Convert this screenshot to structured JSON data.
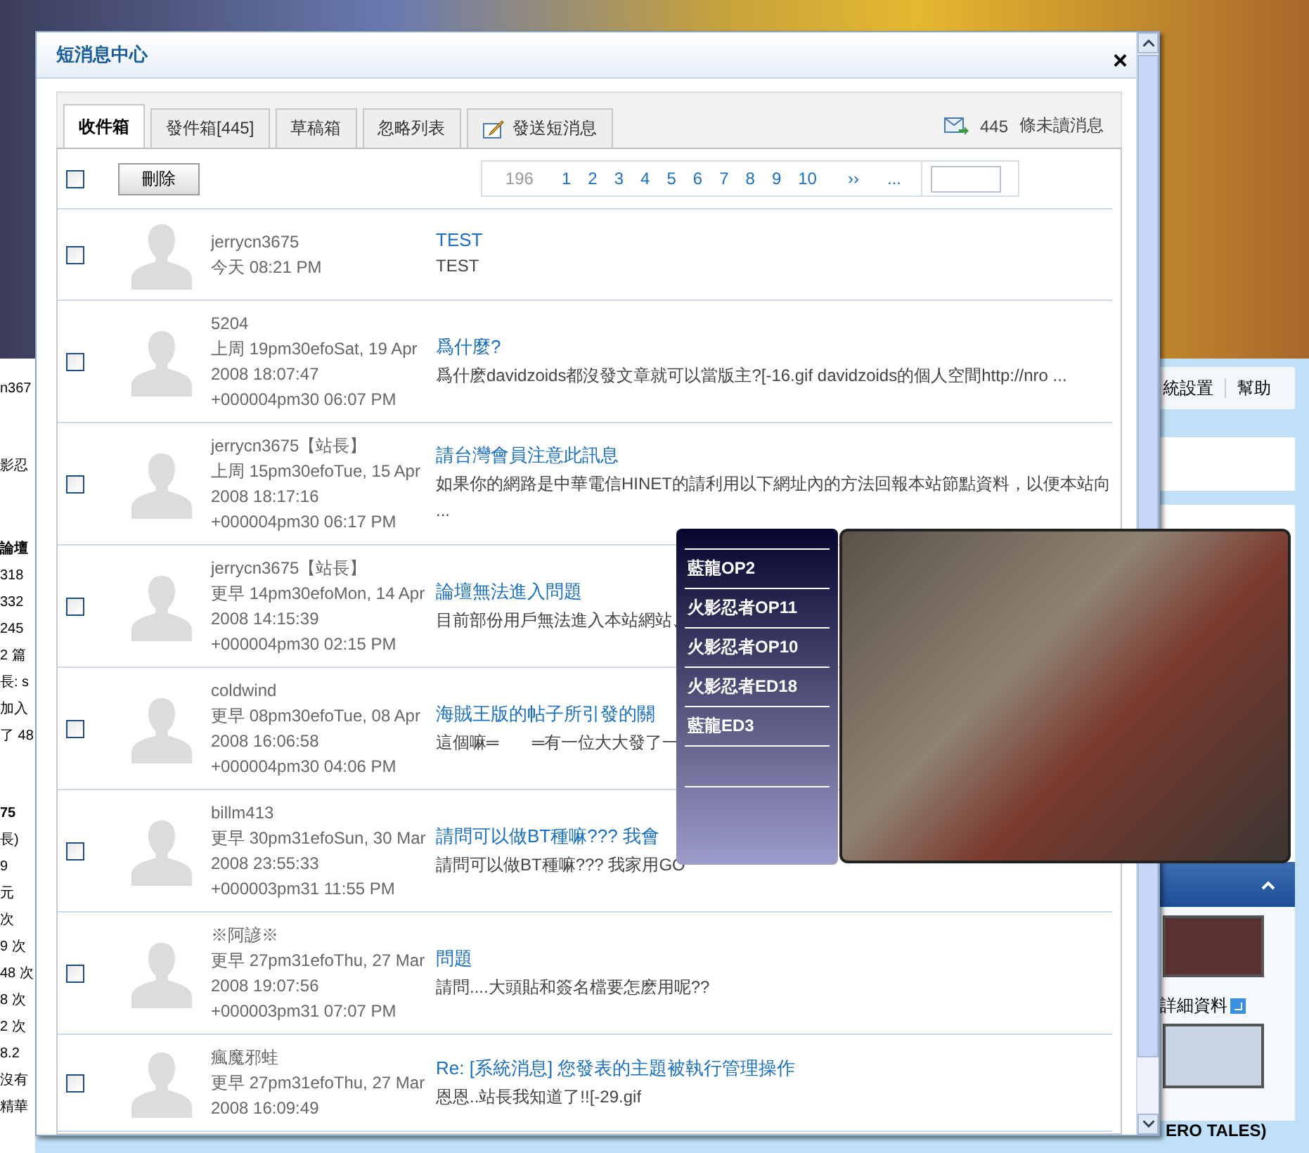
{
  "background": {
    "left_fragments": [
      {
        "kind": "text",
        "lines": [
          "n367"
        ]
      },
      {
        "kind": "text",
        "lines": [
          "影忍"
        ]
      },
      {
        "kind": "heading",
        "lines": [
          "論壇",
          "318",
          "332",
          "245",
          "2 篇",
          "長: s",
          "加入",
          "了 48"
        ]
      },
      {
        "kind": "heading",
        "lines": [
          "75",
          "長)",
          "9",
          "元",
          "次",
          "9 次",
          "48 次",
          "8 次",
          "2 次",
          "8.2",
          "沒有",
          "精華"
        ]
      }
    ],
    "nav_links": [
      "統設置",
      "幫助"
    ],
    "profile_link": "詳細資料",
    "bottom_caption": "ERO TALES)"
  },
  "dialog": {
    "title": "短消息中心",
    "close_label": "×",
    "tabs": [
      {
        "label": "收件箱",
        "selected": true,
        "kind": "plain"
      },
      {
        "label": "發件箱[445]",
        "selected": false,
        "kind": "plain"
      },
      {
        "label": "草稿箱",
        "selected": false,
        "kind": "plain"
      },
      {
        "label": "忽略列表",
        "selected": false,
        "kind": "plain"
      },
      {
        "label": "發送短消息",
        "selected": false,
        "kind": "compose"
      }
    ],
    "unread": {
      "count": "445",
      "label": "條未讀消息"
    },
    "toolbar": {
      "select_all": false,
      "delete_button": "刪除"
    },
    "pagination": {
      "total": "196",
      "pages": [
        "1",
        "2",
        "3",
        "4",
        "5",
        "6",
        "7",
        "8",
        "9",
        "10"
      ],
      "next": "››",
      "more": "..."
    },
    "messages": [
      {
        "checked": false,
        "sender": "jerrycn3675",
        "time_lines": [
          "今天 08:21 PM"
        ],
        "subject": "TEST",
        "preview": "TEST"
      },
      {
        "checked": false,
        "sender": "5204",
        "time_lines": [
          "上周 19pm30efoSat, 19 Apr",
          "2008 18:07:47",
          "+000004pm30 06:07 PM"
        ],
        "subject": "爲什麼?",
        "preview": "爲什麽davidzoids都沒發文章就可以當版主?[-16.gif davidzoids的個人空間http://nro ..."
      },
      {
        "checked": false,
        "sender": "jerrycn3675【站長】",
        "time_lines": [
          "上周 15pm30efoTue, 15 Apr",
          "2008 18:17:16",
          "+000004pm30 06:17 PM"
        ],
        "subject": "請台灣會員注意此訊息",
        "preview": "如果你的網路是中華電信HINET的請利用以下網址內的方法回報本站節點資料，以便本站向 ..."
      },
      {
        "checked": false,
        "sender": "jerrycn3675【站長】",
        "time_lines": [
          "更早 14pm30efoMon, 14 Apr",
          "2008 14:15:39",
          "+000004pm30 02:15 PM"
        ],
        "subject": "論壇無法進入問題",
        "preview": "目前部份用戶無法進入本站網站、"
      },
      {
        "checked": false,
        "sender": "coldwind",
        "time_lines": [
          "更早 08pm30efoTue, 08 Apr",
          "2008 16:06:58",
          "+000004pm30 04:06 PM"
        ],
        "subject": "海賊王版的帖子所引發的關",
        "preview": "這個嘛═　　═有一位大大發了一"
      },
      {
        "checked": false,
        "sender": "billm413",
        "time_lines": [
          "更早 30pm31efoSun, 30 Mar",
          "2008 23:55:33",
          "+000003pm31 11:55 PM"
        ],
        "subject": "請問可以做BT種嘛??? 我會",
        "preview": "請問可以做BT種嘛??? 我家用GO"
      },
      {
        "checked": false,
        "sender": "※阿諺※",
        "time_lines": [
          "更早 27pm31efoThu, 27 Mar",
          "2008 19:07:56",
          "+000003pm31 07:07 PM"
        ],
        "subject": "問題",
        "preview": "請問....大頭貼和簽名檔要怎麽用呢??"
      },
      {
        "checked": false,
        "sender": "瘋魔邪蛙",
        "time_lines": [
          "更早 27pm31efoThu, 27 Mar",
          "2008 16:09:49"
        ],
        "subject": "Re: [系統消息] 您發表的主題被執行管理操作",
        "preview": "恩恩..站長我知道了!![-29.gif"
      }
    ]
  },
  "player": {
    "tracks": [
      "藍龍OP2",
      "火影忍者OP11",
      "火影忍者OP10",
      "火影忍者ED18",
      "藍龍ED3"
    ]
  }
}
